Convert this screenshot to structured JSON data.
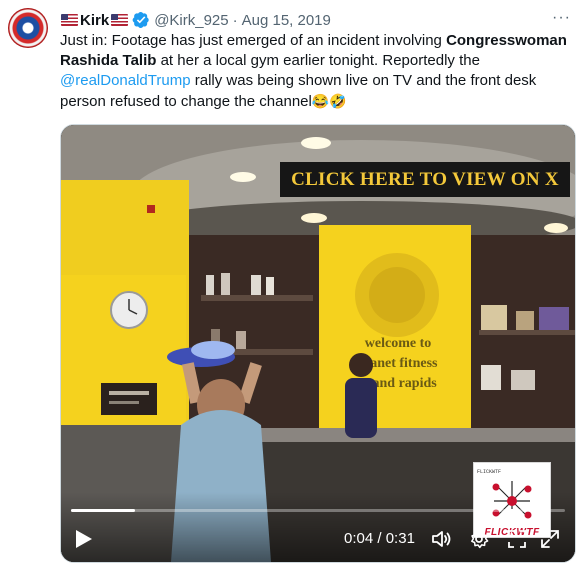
{
  "tweet": {
    "display_name": "Kirk",
    "handle": "@Kirk_925",
    "separator": "·",
    "date": "Aug 15, 2019",
    "more_label": "···",
    "text": {
      "part1": "Just in: Footage has just emerged of an incident involving ",
      "bold": "Congresswoman Rashida Talib",
      "part2": " at her a local gym earlier tonight. Reportedly the ",
      "mention": "@realDonaldTrump",
      "part3": " rally was being shown live on TV and the front desk person refused to change the channel",
      "emoji1": "😂",
      "emoji2": "🤣"
    }
  },
  "media": {
    "cta_text": "CLICK HERE TO VIEW ON X",
    "wall_sign_lines": [
      "welcome to",
      "planet fitness",
      "grand rapids"
    ],
    "time_current": "0:04",
    "time_separator": "/",
    "time_total": "0:31",
    "progress": 0.129,
    "watermark_top": "FLICKWTF",
    "watermark_text": "FLICKWTF"
  },
  "colors": {
    "accent": "#1d9bf0",
    "text_primary": "#0f1419",
    "text_secondary": "#536471",
    "cta_gold": "#f3c83a",
    "wall_yellow": "#f5d21e"
  },
  "icons": {
    "verified": "verified-badge-icon",
    "play": "play-icon",
    "volume": "volume-icon",
    "settings": "settings-gear-icon",
    "fullscreen": "fullscreen-icon",
    "expand": "expand-icon"
  }
}
